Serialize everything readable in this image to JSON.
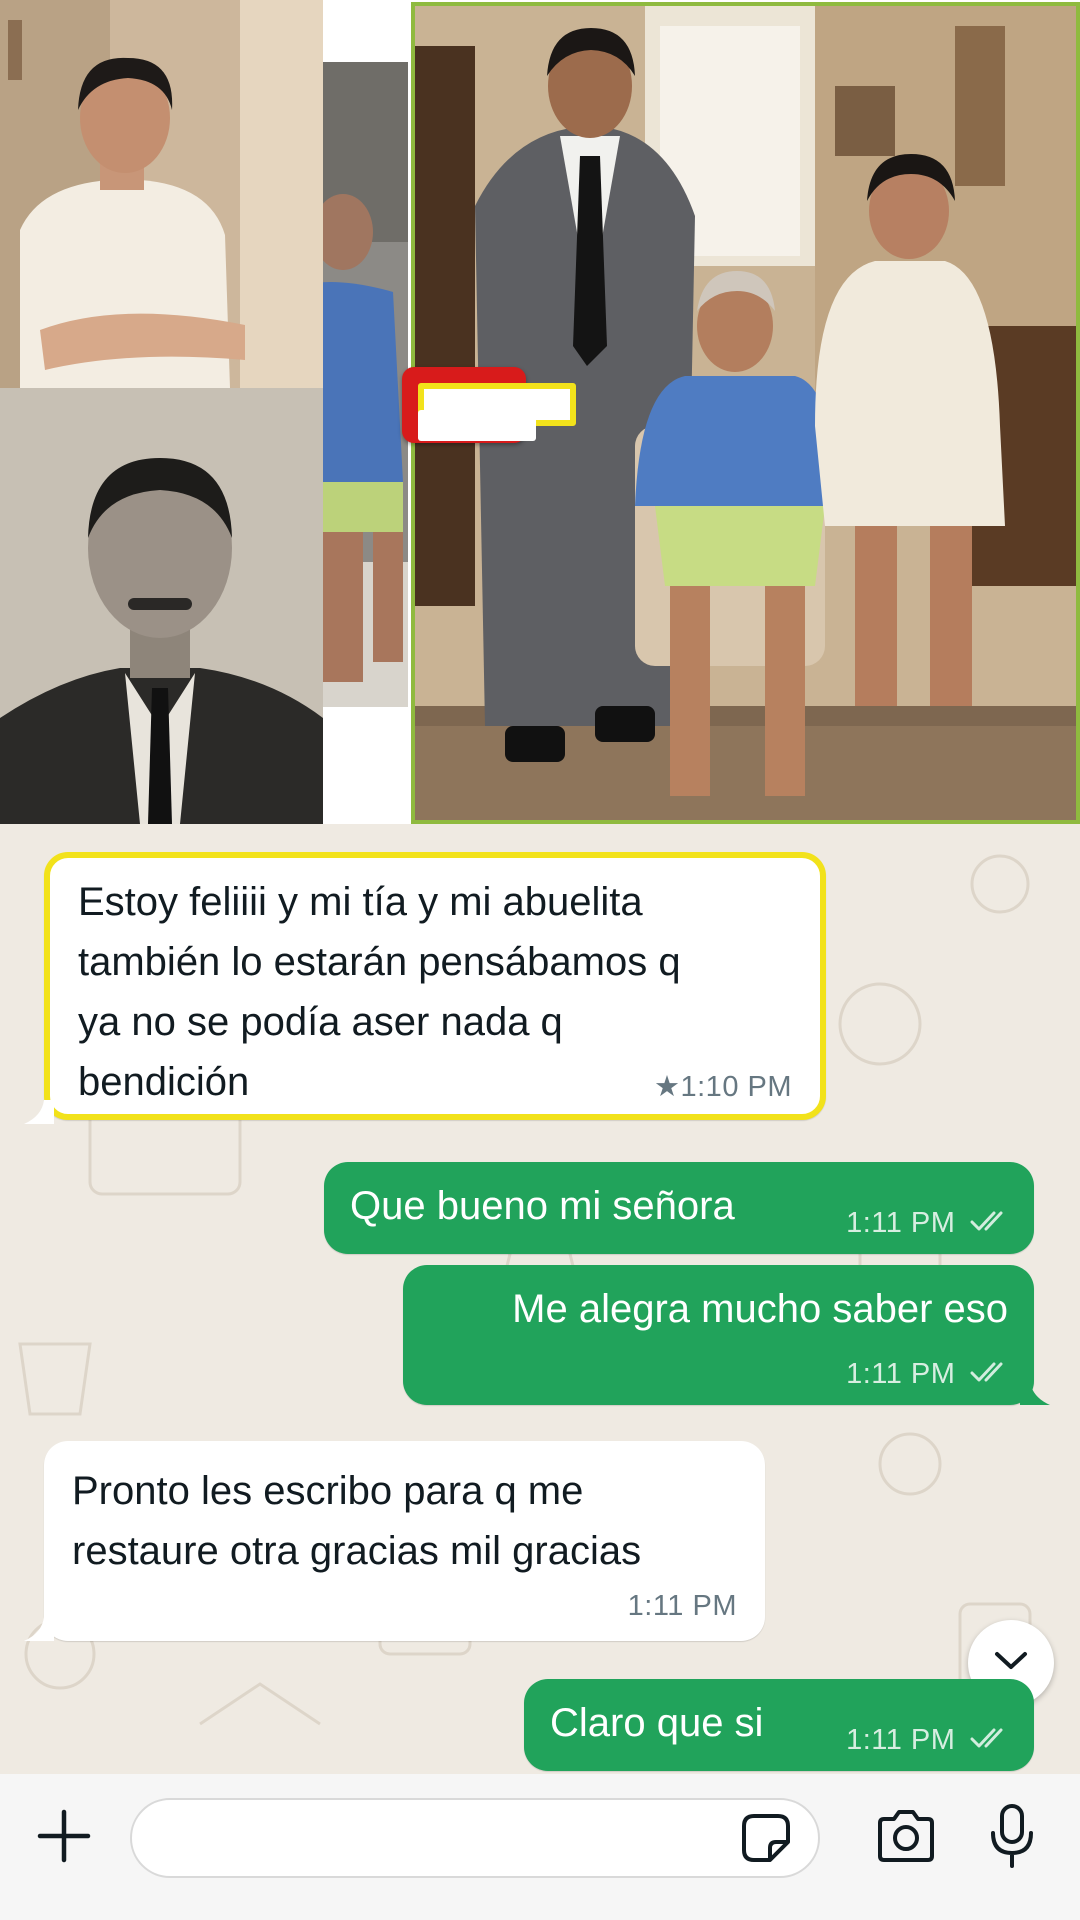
{
  "collage": {
    "photos": [
      "aunt-photo",
      "grandfather-old-photo",
      "grandmother-photo",
      "restored-family-photo"
    ],
    "equals_color": "#d81b1b",
    "highlight_border_color": "#8fba3f"
  },
  "chat": {
    "messages": [
      {
        "direction": "incoming",
        "text": "Estoy feliiii y mi tía y mi abuelita\ntambién lo estarán pensábamos q\nya no se podía aser nada q\nbendición",
        "time": "1:10 PM",
        "starred": true,
        "highlighted": true
      },
      {
        "direction": "outgoing",
        "text": "Que bueno mi señora",
        "time": "1:11 PM",
        "status": "read"
      },
      {
        "direction": "outgoing",
        "text": "Me alegra mucho saber eso",
        "time": "1:11 PM",
        "status": "read"
      },
      {
        "direction": "incoming",
        "text": "Pronto les escribo para q me\nrestaure otra gracias mil gracias",
        "time": "1:11 PM"
      },
      {
        "direction": "outgoing",
        "text": "Claro que si",
        "time": "1:11 PM",
        "status": "read"
      }
    ],
    "colors": {
      "outgoing_bubble": "#21a35b",
      "incoming_bubble": "#ffffff",
      "wallpaper": "#efeae2",
      "highlight": "#f2e21b"
    },
    "scroll_button_icon": "chevron-down-icon"
  },
  "input_bar": {
    "placeholder": "",
    "icons": [
      "plus-icon",
      "sticker-icon",
      "camera-icon",
      "microphone-icon"
    ]
  }
}
